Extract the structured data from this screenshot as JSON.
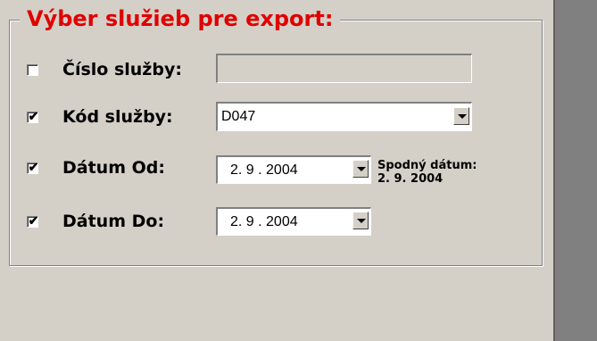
{
  "group": {
    "title": "Výber služieb pre export:"
  },
  "fields": {
    "cislo": {
      "label": "Číslo služby:",
      "checked": false,
      "value": ""
    },
    "kod": {
      "label": "Kód služby:",
      "checked": true,
      "value": "D047"
    },
    "datum_od": {
      "label": "Dátum Od:",
      "checked": true,
      "value": "2. 9 . 2004"
    },
    "datum_do": {
      "label": "Dátum Do:",
      "checked": true,
      "value": "2. 9 . 2004"
    }
  },
  "hint": {
    "line1": "Spodný dátum:",
    "line2": "2. 9. 2004"
  },
  "icons": {
    "checkmark": "✔",
    "dropdown": "chevron-down-icon"
  },
  "colors": {
    "title": "#e00000",
    "background": "#d4d0c8",
    "side_panel": "#808080"
  }
}
